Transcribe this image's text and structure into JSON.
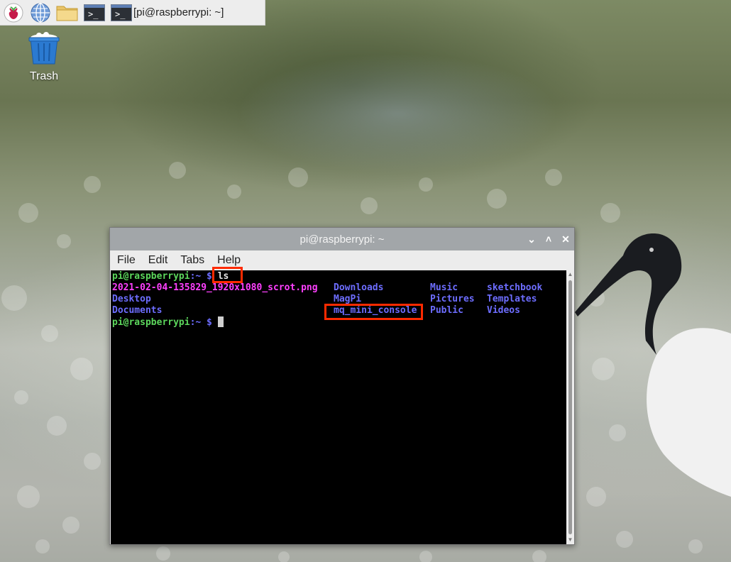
{
  "taskbar": {
    "icons": [
      {
        "name": "raspberry-menu-icon"
      },
      {
        "name": "web-browser-icon"
      },
      {
        "name": "file-manager-icon"
      },
      {
        "name": "terminal-launcher-icon"
      }
    ],
    "task": {
      "icon_glyph": ">_",
      "label": "[pi@raspberrypi: ~]"
    }
  },
  "desktop": {
    "trash": {
      "label": "Trash"
    }
  },
  "window": {
    "title": "pi@raspberrypi: ~",
    "controls": {
      "minimize": "⌄",
      "maximize": "˄",
      "close": "✕"
    },
    "menu": [
      "File",
      "Edit",
      "Tabs",
      "Help"
    ]
  },
  "terminal": {
    "prompt_user": "pi@raspberrypi",
    "prompt_path": ":~ $",
    "command": "ls",
    "listing": {
      "row1": [
        "2021-02-04-135829_1920x1080_scrot.png",
        "Downloads",
        "Music",
        "sketchbook"
      ],
      "row2": [
        "Desktop",
        "MagPi",
        "Pictures",
        "Templates"
      ],
      "row3": [
        "Documents",
        "mq_mini_console",
        "Public",
        "Videos"
      ]
    }
  },
  "colors": {
    "prompt_green": "#5cd65c",
    "dir_blue": "#6d6dff",
    "image_magenta": "#ff40ff",
    "highlight_red": "#ff2a00"
  }
}
